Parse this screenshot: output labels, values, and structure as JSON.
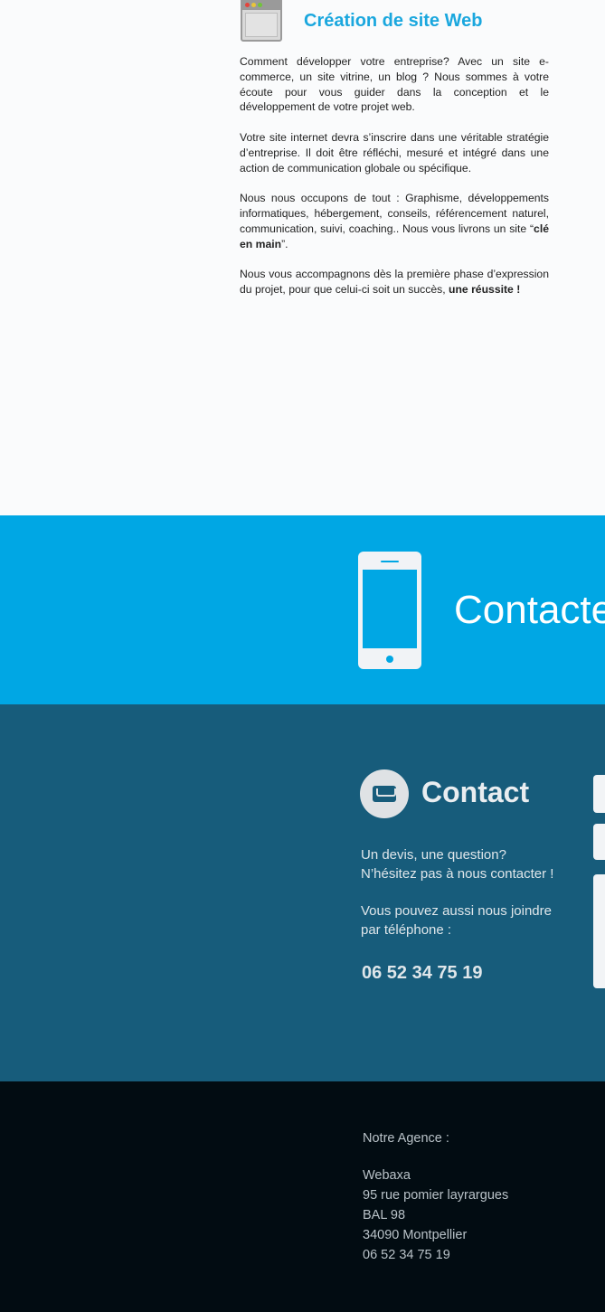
{
  "web_section": {
    "title": "Création de site Web",
    "icon": "browser-window-icon",
    "paragraphs": [
      "Comment développer votre entreprise? Avec un site e-commerce, un site vitrine, un blog ? Nous sommes à votre écoute pour vous guider dans la conception et le développement de votre projet web.",
      "Votre site internet devra s’inscrire dans une véritable stratégie d’entreprise. Il doit être réfléchi, mesuré et intégré dans une action de communication globale ou spécifique."
    ],
    "p3_text": "Nous nous occupons de tout : Graphisme, développements informatiques, hébergement, conseils,  référencement naturel, communication,  suivi, coaching.. Nous vous livrons un site “",
    "p3_bold": "clé en main",
    "p3_end": "”.",
    "p4_text": "Nous vous accompagnons dès la première phase d’expression du projet, pour que celui-ci soit un succès, ",
    "p4_bold": "une réussite !"
  },
  "banner": {
    "text": "Contacte",
    "icon": "mobile-phone-icon",
    "color": "#00a7e4"
  },
  "contact": {
    "title": "Contact",
    "icon": "envelope-icon",
    "line1": "Un devis, une question?",
    "line2": "N’hésitez pas à nous contacter !",
    "line3": "Vous pouvez aussi nous joindre",
    "line4": "par téléphone :",
    "phone": "06 52 34 75 19",
    "color": "#175c7b"
  },
  "footer": {
    "heading": "Notre Agence :",
    "company": "Webaxa",
    "street": "95 rue pomier layrargues",
    "box": "BAL 98",
    "city": "34090 Montpellier",
    "phone": "06 52 34 75 19"
  }
}
